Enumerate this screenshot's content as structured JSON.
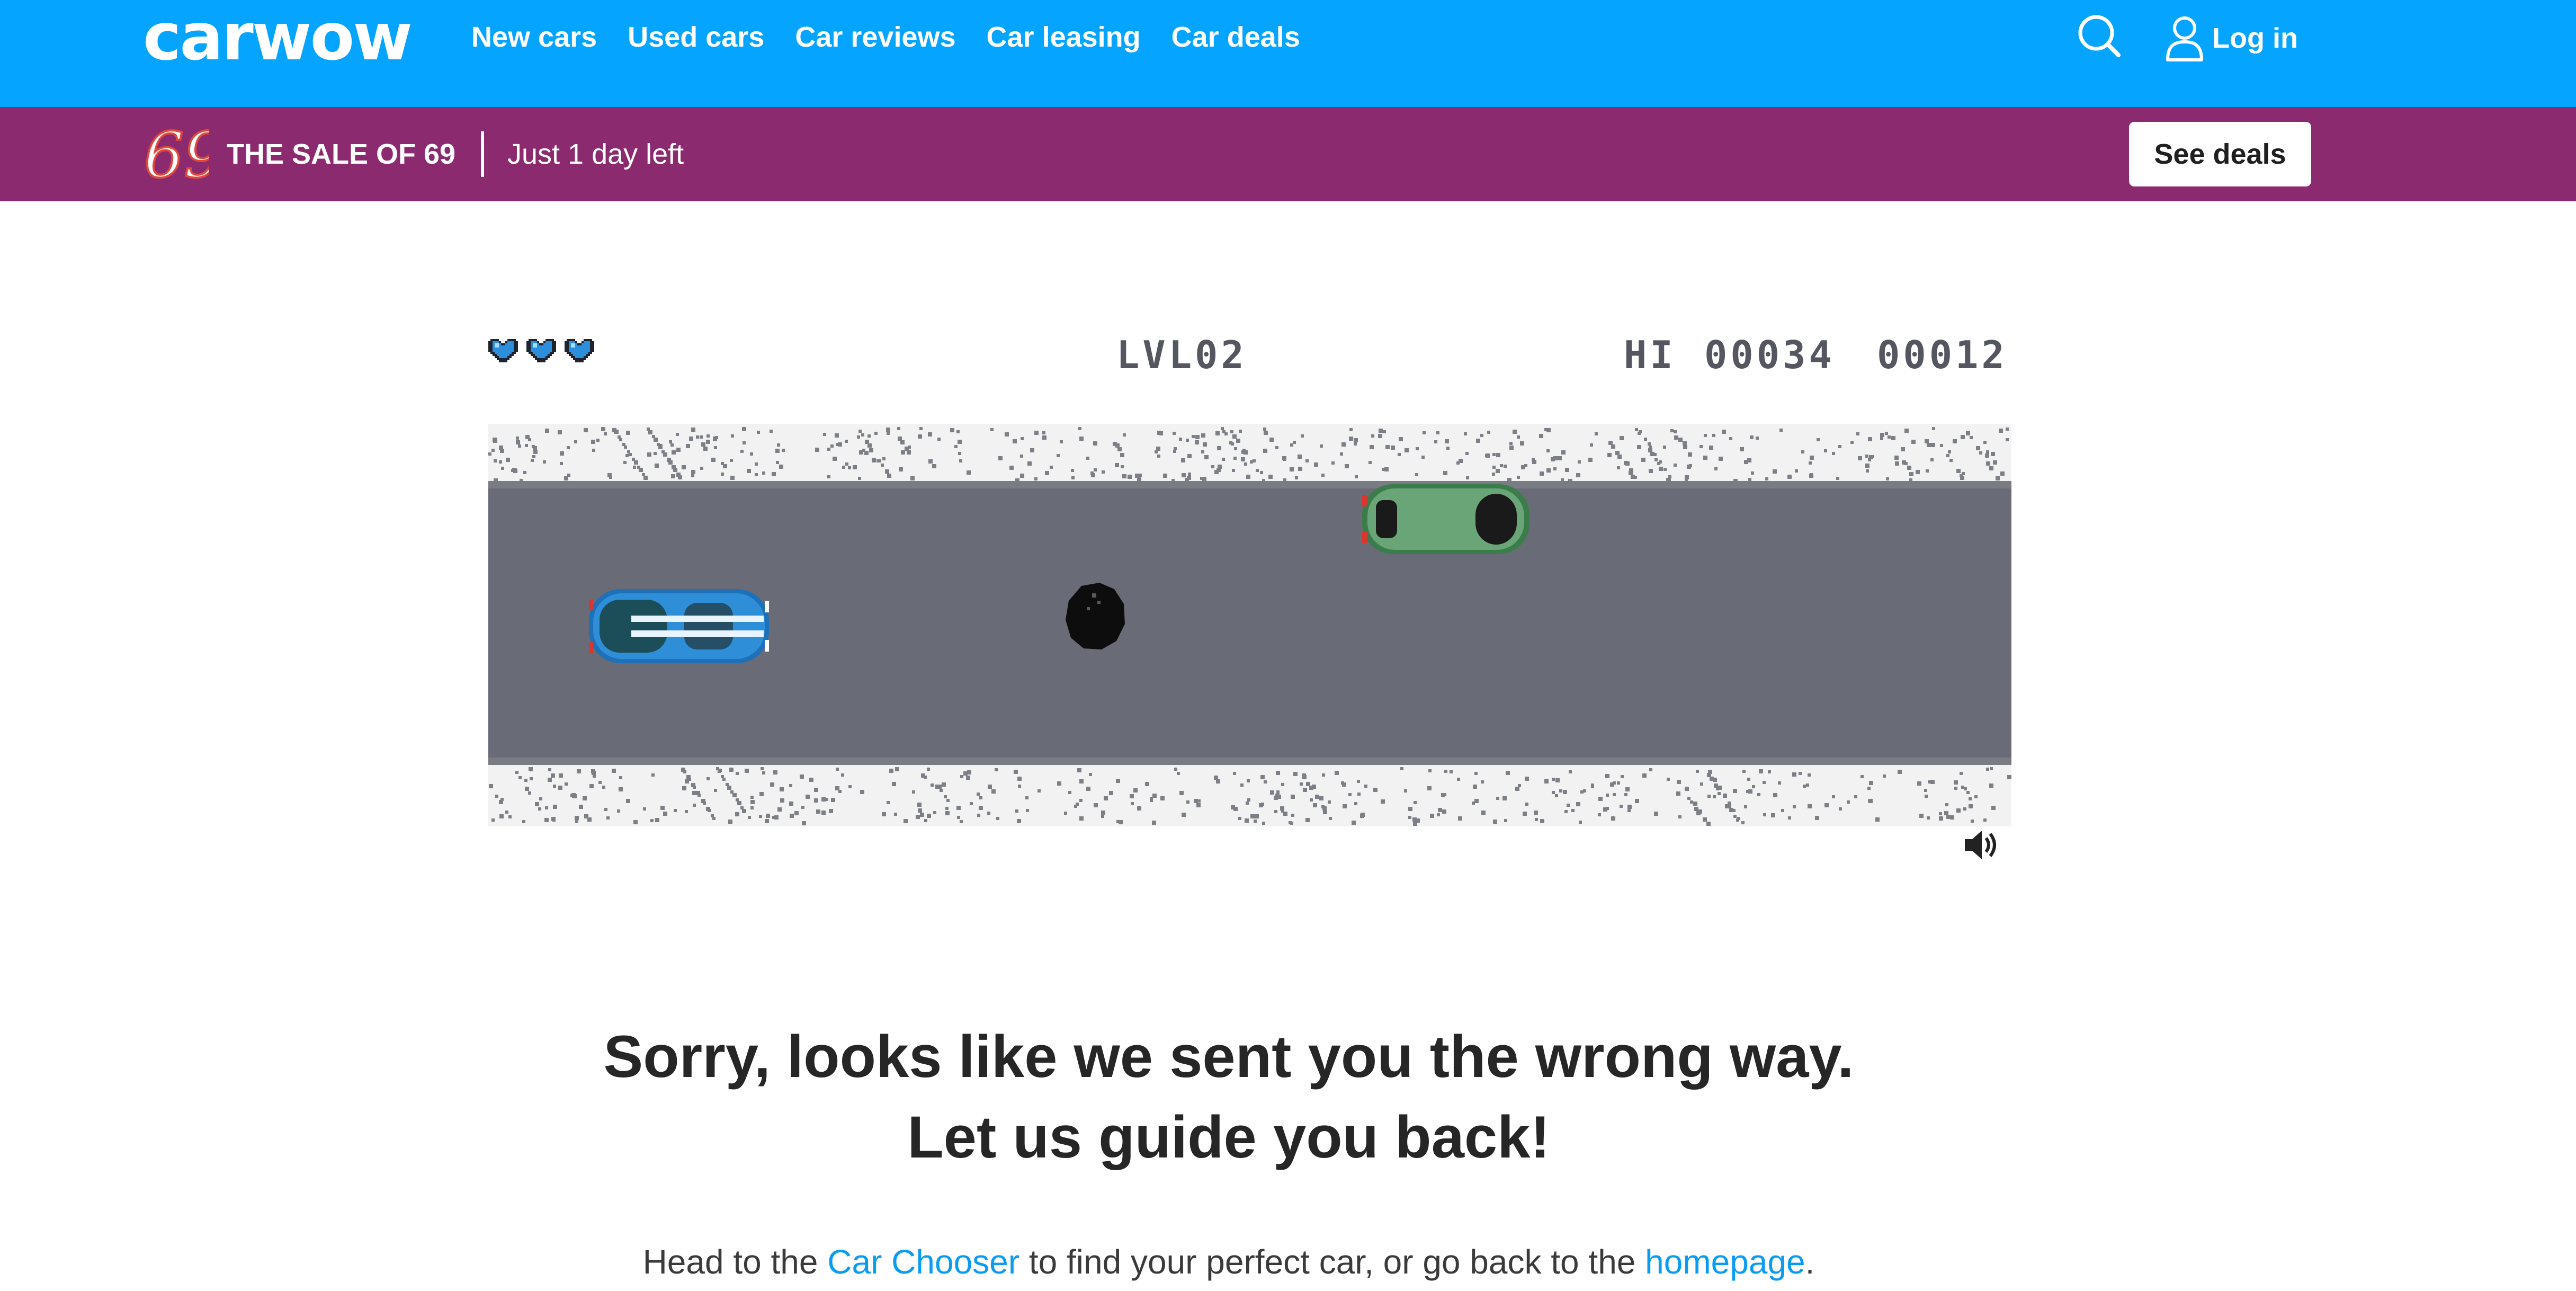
{
  "brand": {
    "logo_text": "carwow"
  },
  "nav": {
    "links": [
      "New cars",
      "Used cars",
      "Car reviews",
      "Car leasing",
      "Car deals"
    ],
    "search_icon": "search-icon",
    "login_label": "Log in",
    "login_icon": "user-icon"
  },
  "sale": {
    "badge_number": "69",
    "title": "THE SALE OF 69",
    "subtitle": "Just 1 day left",
    "cta_label": "See deals"
  },
  "game": {
    "lives": 3,
    "level": "LVL02",
    "hi_label": "HI",
    "hi_score": "00034",
    "score": "00012",
    "sound_icon": "speaker-icon"
  },
  "message": {
    "line1": "Sorry, looks like we sent you the wrong way.",
    "line2": "Let us guide you back!",
    "help_prefix": "Head to the ",
    "car_chooser_link": "Car Chooser",
    "help_middle": " to find your perfect car, or go back to the ",
    "homepage_link": "homepage",
    "help_suffix": "."
  },
  "colors": {
    "nav_bg": "#05a5ff",
    "sale_bg": "#8c2a6f",
    "road": "#696c77",
    "link": "#0a9cf0"
  }
}
